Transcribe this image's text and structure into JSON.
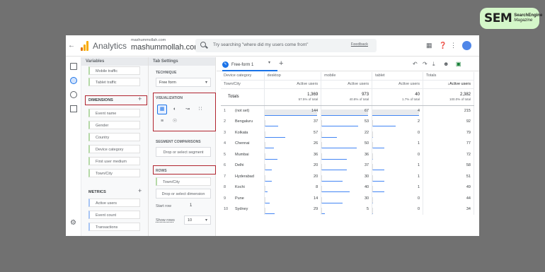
{
  "brand_badge": {
    "big": "SEM",
    "small1": "SearchEngine",
    "small2": "Magazine"
  },
  "header": {
    "app_title": "Analytics",
    "account_domain": "mashummollah.com",
    "account_name": "mashummollah.com",
    "search_placeholder": "Try searching \"where did my users come from\"",
    "feedback_link": "Feedback"
  },
  "variables_panel": {
    "title": "Variables",
    "segments": [
      "Mobile traffic",
      "Tablet traffic"
    ],
    "dimensions_label": "DIMENSIONS",
    "dimensions": [
      "Event name",
      "Gender",
      "Country",
      "Device category",
      "First user medium",
      "Town/City"
    ],
    "metrics_label": "METRICS",
    "metrics": [
      "Active users",
      "Event count",
      "Transactions"
    ]
  },
  "tab_settings": {
    "title": "Tab Settings",
    "technique_label": "TECHNIQUE",
    "technique_value": "Free form",
    "visualization_label": "VISUALIZATION",
    "segment_comparisons_label": "SEGMENT COMPARISONS",
    "segment_drop": "Drop or select segment",
    "rows_label": "ROWS",
    "rows_chip": "Town/City",
    "rows_drop": "Drop or select dimension",
    "start_row_label": "Start row",
    "start_row_value": "1",
    "show_rows_label": "Show rows",
    "show_rows_value": "10"
  },
  "report": {
    "tab_name": "Free-form 1",
    "col_header_label": "Device category",
    "row_dim_label": "Town/City",
    "columns": [
      "desktop",
      "mobile",
      "tablet",
      "Totals"
    ],
    "metric_headers": [
      "Active users",
      "Active users",
      "Active users",
      "↓Active users"
    ],
    "totals_label": "Totals",
    "totals": [
      {
        "value": "1,369",
        "pct": "57.5% of total"
      },
      {
        "value": "973",
        "pct": "40.8% of total"
      },
      {
        "value": "40",
        "pct": "1.7% of total"
      },
      {
        "value": "2,382",
        "pct": "100.0% of total"
      }
    ],
    "rows": [
      {
        "n": "1",
        "city": "(not set)",
        "desktop": "144",
        "mobile": "67",
        "tablet": "4",
        "total": "215",
        "bars": [
          1.0,
          1.0,
          1.0
        ]
      },
      {
        "n": "2",
        "city": "Bengaluru",
        "desktop": "37",
        "mobile": "53",
        "tablet": "2",
        "total": "92",
        "bars": [
          0.26,
          0.79,
          0.5
        ]
      },
      {
        "n": "3",
        "city": "Kolkata",
        "desktop": "57",
        "mobile": "22",
        "tablet": "0",
        "total": "79",
        "bars": [
          0.4,
          0.33,
          0.0
        ]
      },
      {
        "n": "4",
        "city": "Chennai",
        "desktop": "26",
        "mobile": "50",
        "tablet": "1",
        "total": "77",
        "bars": [
          0.18,
          0.75,
          0.25
        ]
      },
      {
        "n": "5",
        "city": "Mumbai",
        "desktop": "36",
        "mobile": "36",
        "tablet": "0",
        "total": "72",
        "bars": [
          0.25,
          0.54,
          0.0
        ]
      },
      {
        "n": "6",
        "city": "Delhi",
        "desktop": "20",
        "mobile": "37",
        "tablet": "1",
        "total": "58",
        "bars": [
          0.14,
          0.55,
          0.25
        ]
      },
      {
        "n": "7",
        "city": "Hyderabad",
        "desktop": "20",
        "mobile": "30",
        "tablet": "1",
        "total": "51",
        "bars": [
          0.14,
          0.45,
          0.25
        ]
      },
      {
        "n": "8",
        "city": "Kochi",
        "desktop": "8",
        "mobile": "40",
        "tablet": "1",
        "total": "49",
        "bars": [
          0.06,
          0.6,
          0.25
        ]
      },
      {
        "n": "9",
        "city": "Pune",
        "desktop": "14",
        "mobile": "30",
        "tablet": "0",
        "total": "44",
        "bars": [
          0.1,
          0.45,
          0.0
        ]
      },
      {
        "n": "10",
        "city": "Sydney",
        "desktop": "29",
        "mobile": "5",
        "tablet": "0",
        "total": "34",
        "bars": [
          0.2,
          0.07,
          0.0
        ]
      }
    ]
  },
  "colors": {
    "accent": "#1a73e8",
    "highlight": "#b1242f",
    "bar_blue": "#4285f4"
  }
}
